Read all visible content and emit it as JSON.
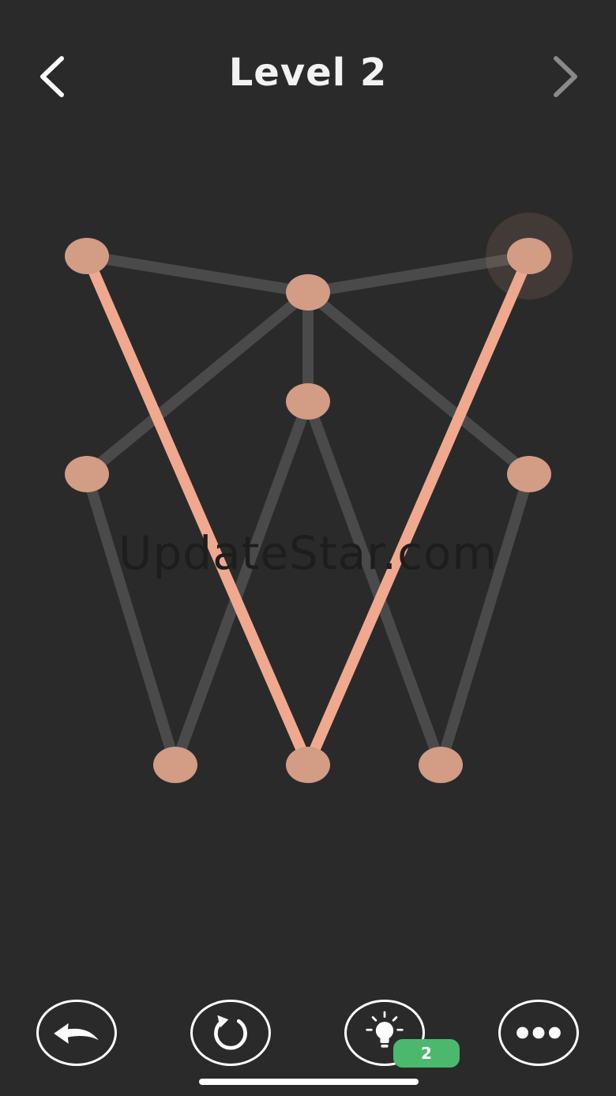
{
  "header": {
    "title": "Level 2",
    "prev_icon": "chevron-left-icon",
    "next_icon": "chevron-right-icon"
  },
  "watermark": "UpdateStar.com",
  "colors": {
    "background": "#2a2a2a",
    "node": "#d29c85",
    "path_active": "#f0a98e",
    "path_inactive": "#4a4a4a",
    "hint_badge": "#4cb86e"
  },
  "puzzle": {
    "nodes": [
      {
        "id": "top-left"
      },
      {
        "id": "top-center"
      },
      {
        "id": "top-right"
      },
      {
        "id": "middle"
      },
      {
        "id": "mid-left"
      },
      {
        "id": "mid-right"
      },
      {
        "id": "bottom-left"
      },
      {
        "id": "bottom-center"
      },
      {
        "id": "bottom-right"
      }
    ],
    "edges": [
      {
        "from": "top-left",
        "to": "top-center",
        "drawn": false
      },
      {
        "from": "top-center",
        "to": "top-right",
        "drawn": false
      },
      {
        "from": "top-center",
        "to": "middle",
        "drawn": false
      },
      {
        "from": "top-center",
        "to": "mid-left",
        "drawn": false
      },
      {
        "from": "top-center",
        "to": "mid-right",
        "drawn": false
      },
      {
        "from": "mid-left",
        "to": "bottom-left",
        "drawn": false
      },
      {
        "from": "bottom-left",
        "to": "middle",
        "drawn": false
      },
      {
        "from": "middle",
        "to": "bottom-right",
        "drawn": false
      },
      {
        "from": "bottom-right",
        "to": "mid-right",
        "drawn": false
      },
      {
        "from": "top-left",
        "to": "bottom-center",
        "drawn": true
      },
      {
        "from": "bottom-center",
        "to": "top-right",
        "drawn": true
      }
    ],
    "current_node": "top-right"
  },
  "toolbar": {
    "undo_icon": "undo-arrow-icon",
    "restart_icon": "restart-icon",
    "hint_icon": "lightbulb-icon",
    "more_icon": "more-dots-icon",
    "hint_count": "2"
  }
}
